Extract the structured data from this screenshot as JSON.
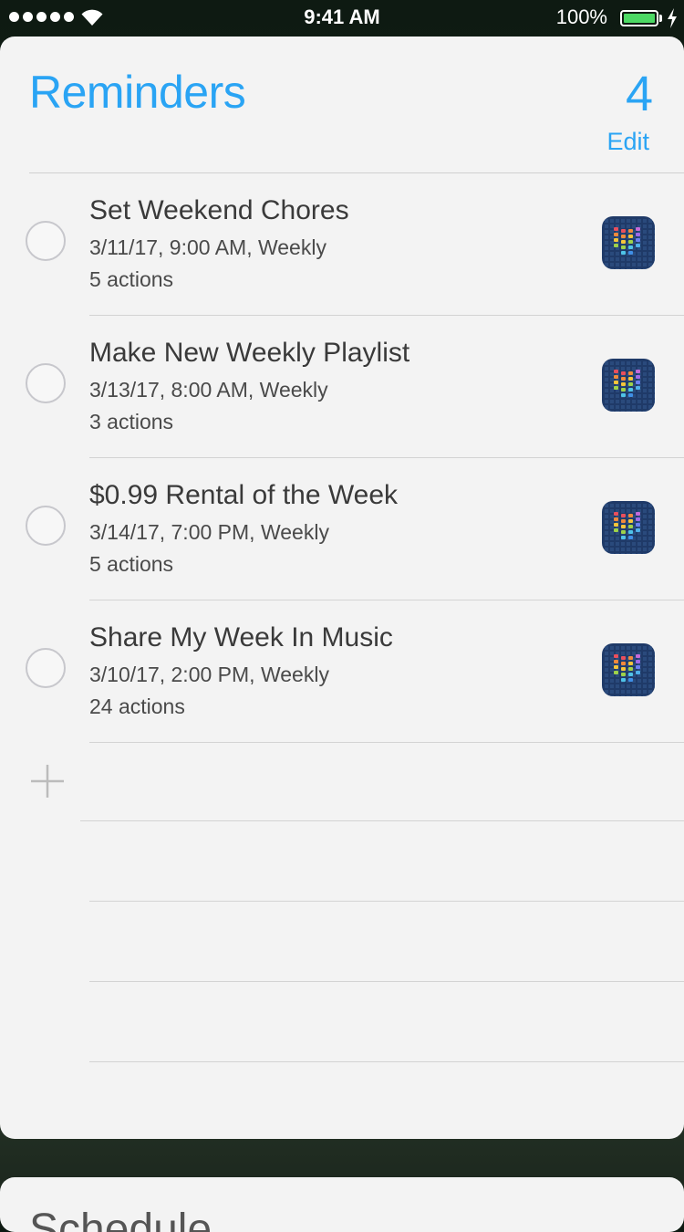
{
  "status_bar": {
    "time": "9:41 AM",
    "battery_percent": "100%",
    "signal_bars": 5,
    "icons": [
      "signal-dots-icon",
      "wifi-icon",
      "battery-icon",
      "charging-bolt-icon"
    ]
  },
  "widget": {
    "title": "Reminders",
    "count": "4",
    "edit_label": "Edit",
    "accent_color": "#2aa4f4",
    "items": [
      {
        "title": "Set Weekend Chores",
        "subtitle": "3/11/17, 9:00 AM, Weekly",
        "actions": "5 actions",
        "icon": "workflow-app-icon"
      },
      {
        "title": "Make New Weekly Playlist",
        "subtitle": "3/13/17, 8:00 AM, Weekly",
        "actions": "3 actions",
        "icon": "workflow-app-icon"
      },
      {
        "title": "$0.99 Rental of the Week",
        "subtitle": "3/14/17, 7:00 PM, Weekly",
        "actions": "5 actions",
        "icon": "workflow-app-icon"
      },
      {
        "title": "Share My Week In Music",
        "subtitle": "3/10/17, 2:00 PM, Weekly",
        "actions": "24 actions",
        "icon": "workflow-app-icon"
      }
    ],
    "add_icon": "plus-icon"
  },
  "next_widget": {
    "title": "Schedule"
  }
}
